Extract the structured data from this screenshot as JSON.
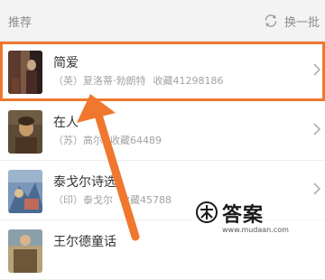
{
  "header": {
    "title": "推荐",
    "refresh_label": "换一批",
    "refresh_icon": "refresh-icon"
  },
  "books": [
    {
      "title": "简爱",
      "author": "（英）夏洛蒂·勃朗特",
      "collect": "收藏41298186",
      "highlighted": true
    },
    {
      "title": "在人",
      "author": "（苏）高尔",
      "collect": "收藏64489",
      "highlighted": false
    },
    {
      "title": "泰戈尔诗选",
      "author": "（印）泰戈尔",
      "collect": "收藏45788",
      "highlighted": false
    },
    {
      "title": "王尔德童话",
      "author": "",
      "collect": "",
      "highlighted": false
    }
  ],
  "colors": {
    "accent_highlight": "#f0782e",
    "meta_text": "#a3a3a3",
    "title_text": "#333333"
  },
  "watermark": {
    "text_cn": "答案",
    "url": "www.mudaan.com"
  }
}
